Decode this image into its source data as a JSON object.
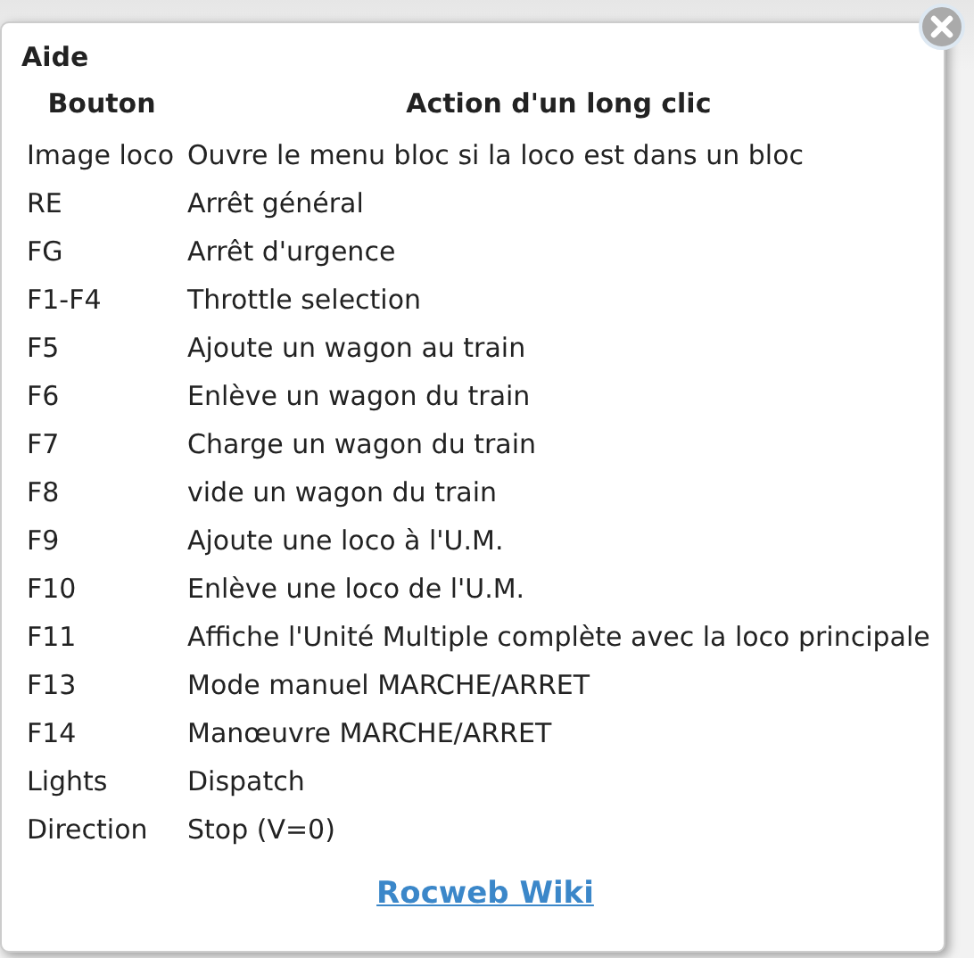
{
  "dialog": {
    "title": "Aide"
  },
  "table": {
    "columns": [
      "Bouton",
      "Action d'un long clic"
    ],
    "rows": [
      [
        "Image loco",
        "Ouvre le menu bloc si la loco est dans un bloc"
      ],
      [
        "RE",
        "Arrêt général"
      ],
      [
        "FG",
        "Arrêt d'urgence"
      ],
      [
        "F1-F4",
        "Throttle selection"
      ],
      [
        "F5",
        "Ajoute un wagon au train"
      ],
      [
        "F6",
        "Enlève un wagon du train"
      ],
      [
        "F7",
        "Charge un wagon du train"
      ],
      [
        "F8",
        "vide un wagon du train"
      ],
      [
        "F9",
        "Ajoute une loco à l'U.M."
      ],
      [
        "F10",
        "Enlève une loco de l'U.M."
      ],
      [
        "F11",
        "Affiche l'Unité Multiple complète avec la loco principale"
      ],
      [
        "F13",
        "Mode manuel MARCHE/ARRET"
      ],
      [
        "F14",
        "Manœuvre MARCHE/ARRET"
      ],
      [
        "Lights",
        "Dispatch"
      ],
      [
        "Direction",
        "Stop (V=0)"
      ]
    ]
  },
  "link": "Rocweb Wiki"
}
